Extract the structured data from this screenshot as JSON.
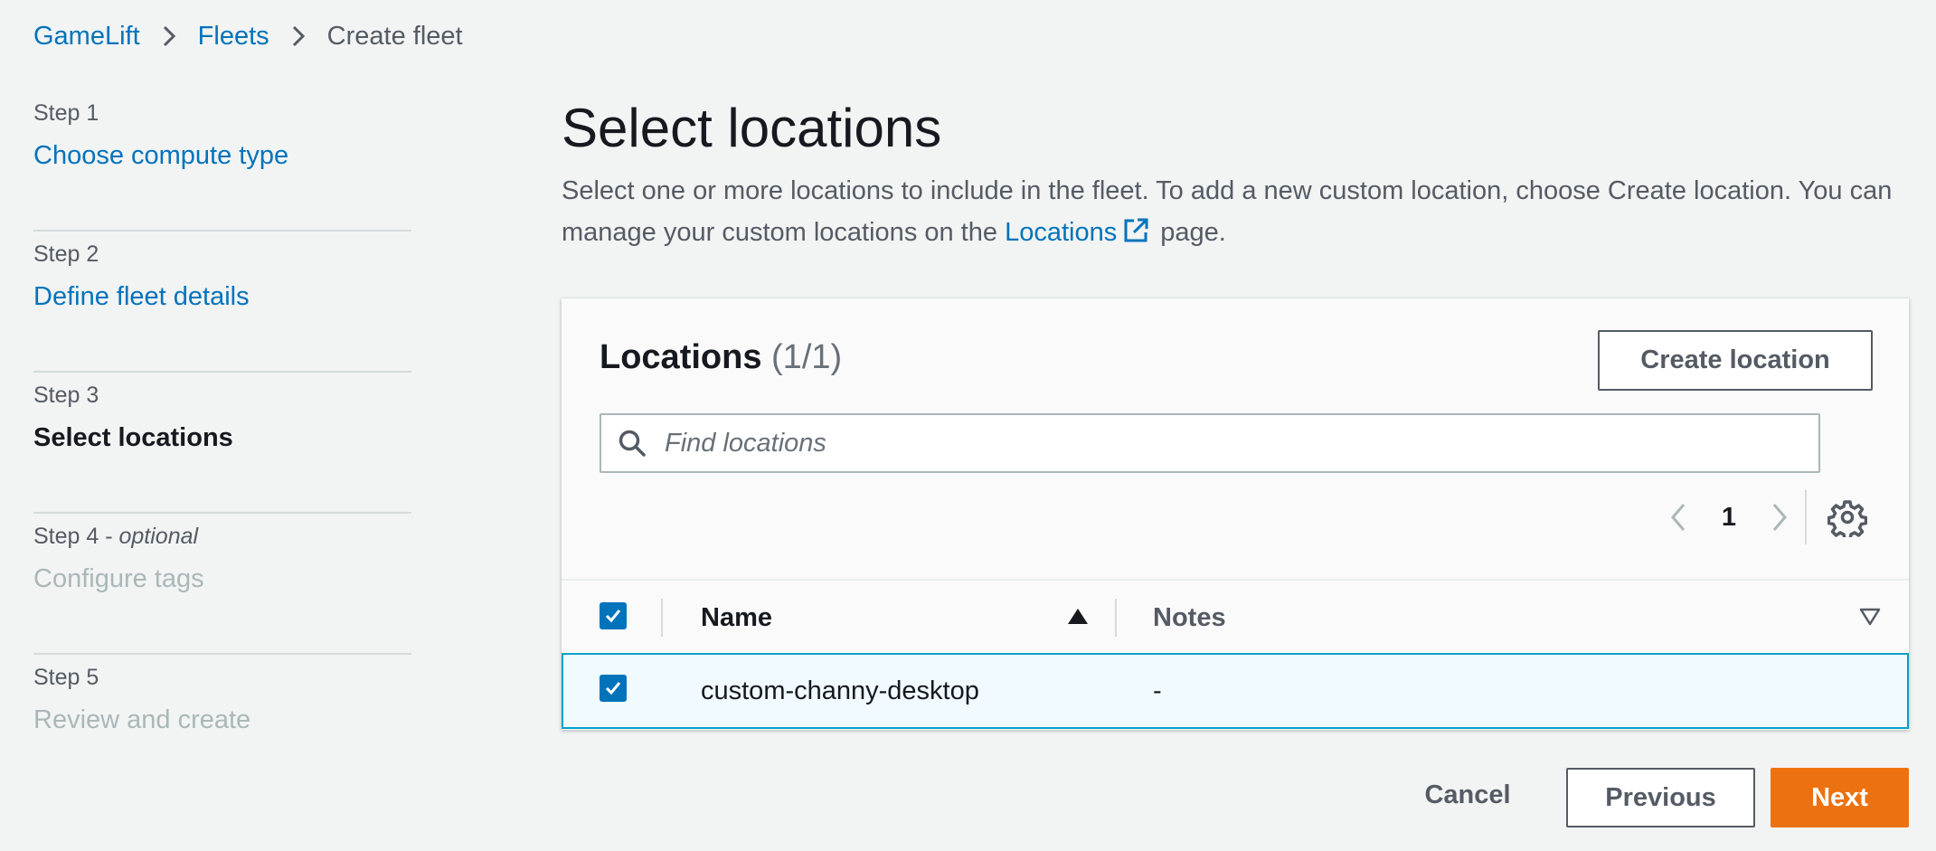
{
  "breadcrumb": {
    "items": [
      "GameLift",
      "Fleets",
      "Create fleet"
    ]
  },
  "steps": [
    {
      "number": "Step 1",
      "optional": "",
      "title": "Choose compute type",
      "state": "link"
    },
    {
      "number": "Step 2",
      "optional": "",
      "title": "Define fleet details",
      "state": "link"
    },
    {
      "number": "Step 3",
      "optional": "",
      "title": "Select locations",
      "state": "current"
    },
    {
      "number": "Step 4 - ",
      "optional": "optional",
      "title": "Configure tags",
      "state": "disabled"
    },
    {
      "number": "Step 5",
      "optional": "",
      "title": "Review and create",
      "state": "disabled"
    }
  ],
  "main": {
    "title": "Select locations",
    "description_part1": "Select one or more locations to include in the fleet. To add a new custom location, choose Create location. You can manage your custom locations on the ",
    "description_link": "Locations",
    "description_part2": " page."
  },
  "locations": {
    "title": "Locations",
    "count": "(1/1)",
    "create_button": "Create location",
    "search_placeholder": "Find locations",
    "page": "1",
    "columns": {
      "name": "Name",
      "notes": "Notes"
    },
    "rows": [
      {
        "name": "custom-channy-desktop",
        "notes": "-",
        "selected": true
      }
    ]
  },
  "footer": {
    "cancel": "Cancel",
    "previous": "Previous",
    "next": "Next"
  },
  "colors": {
    "link": "#0073bb",
    "primary_button": "#ec7211",
    "selected_row_border": "#00a1c9",
    "selected_row_bg": "#f1faff"
  }
}
